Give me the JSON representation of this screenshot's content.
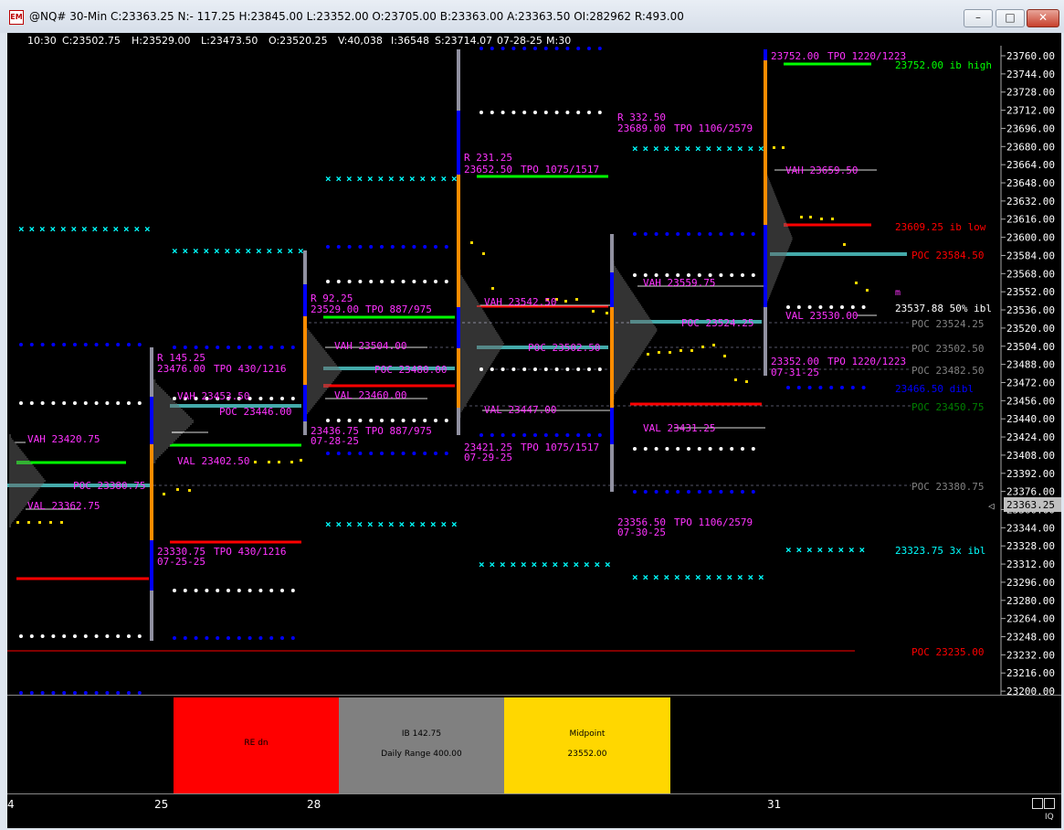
{
  "window": {
    "title": "@NQ# 30-Min C:23363.25 N:- 117.25 H:23845.00 L:23352.00 O:23705.00 B:23363.00 A:23363.50 OI:282962 R:493.00",
    "icon_label": "EM",
    "minimize": "–",
    "maximize": "□",
    "close": "✕"
  },
  "info_bar": {
    "time": "10:30",
    "close": "C:23502.75",
    "high": "H:23529.00",
    "low": "L:23473.50",
    "open": "O:23520.25",
    "volume": "V:40,038",
    "interest": "I:36548",
    "s": "S:23714.07",
    "date": "07-28-25",
    "interval": "M:30"
  },
  "price_axis": {
    "ticks": [
      "23760.00",
      "23744.00",
      "23728.00",
      "23712.00",
      "23696.00",
      "23680.00",
      "23664.00",
      "23648.00",
      "23632.00",
      "23616.00",
      "23600.00",
      "23584.00",
      "23568.00",
      "23552.00",
      "23536.00",
      "23520.00",
      "23504.00",
      "23488.00",
      "23472.00",
      "23456.00",
      "23440.00",
      "23424.00",
      "23408.00",
      "23392.00",
      "23376.00",
      "23360.00",
      "23344.00",
      "23328.00",
      "23312.00",
      "23296.00",
      "23280.00",
      "23264.00",
      "23248.00",
      "23232.00",
      "23216.00",
      "23200.00"
    ],
    "current": "23363.25"
  },
  "day_stats": [
    {
      "range": "R 145.25",
      "high": "23476.00",
      "tpo_top": "TPO 430/1216",
      "vah": "VAH 23453.50",
      "poc": "POC 23446.00",
      "val": "VAL 23402.50",
      "low": "23330.75",
      "tpo_bottom": "TPO 430/1216",
      "date": "07-25-25"
    },
    {
      "range": "R 92.25",
      "high": "23529.00",
      "tpo_top": "TPO 887/975",
      "vah": "VAH 23504.00",
      "poc": "POC 23480.00",
      "val": "VAL 23460.00",
      "low": "23436.75",
      "tpo_bottom": "TPO 887/975",
      "date": "07-28-25"
    },
    {
      "range": "R 231.25",
      "high": "23652.50",
      "tpo_top": "TPO 1075/1517",
      "vah": "VAH 23542.50",
      "poc": "POC 23502.50",
      "val": "VAL 23447.00",
      "low": "23421.25",
      "tpo_bottom": "TPO 1075/1517",
      "date": "07-29-25"
    },
    {
      "range": "R 332.50",
      "high": "23689.00",
      "tpo_top": "TPO 1106/2579",
      "vah": "VAH 23559.75",
      "poc": "POC 23524.25",
      "val": "VAL 23431.25",
      "low": "23356.50",
      "tpo_bottom": "TPO 1106/2579",
      "date": "07-30-25"
    },
    {
      "high": "23752.00",
      "tpo_top": "TPO 1220/1223",
      "vah": "VAH 23659.50",
      "val": "VAL 23530.00",
      "low": "23352.00",
      "tpo_bottom": "TPO 1220/1223",
      "date": "07-31-25"
    }
  ],
  "prev_day": {
    "vah": "VAH 23420.75",
    "poc": "POC 23380.75",
    "val": "VAL 23362.75"
  },
  "level_labels": [
    {
      "text": "23752.00 ib high",
      "color": "#00ff00"
    },
    {
      "text": "23609.25 ib low",
      "color": "#ff0000"
    },
    {
      "text": "POC 23584.50",
      "color": "#ff0000"
    },
    {
      "text": "m",
      "color": "#ff33ff"
    },
    {
      "text": "23537.88 50% ibl",
      "color": "#ffffff"
    },
    {
      "text": "POC 23524.25",
      "color": "#808080"
    },
    {
      "text": "POC 23502.50",
      "color": "#808080"
    },
    {
      "text": "POC 23482.50",
      "color": "#808080"
    },
    {
      "text": "23466.50 dibl",
      "color": "#0000ff"
    },
    {
      "text": "POC 23450.75",
      "color": "#008000"
    },
    {
      "text": "POC 23380.75",
      "color": "#808080"
    },
    {
      "text": "23323.75 3x ibl",
      "color": "#00ffff"
    },
    {
      "text": "POC 23235.00",
      "color": "#ff0000"
    }
  ],
  "panel": {
    "re": {
      "label": "RE dn",
      "color": "#ff0000"
    },
    "ib": {
      "label1": "IB 142.75",
      "label2": "Daily Range 400.00",
      "color": "#808080"
    },
    "mid": {
      "label1": "Midpoint",
      "label2": "23552.00",
      "color": "#ffd700"
    }
  },
  "date_axis": {
    "labels": [
      "4",
      "25",
      "28",
      "31"
    ],
    "corner": "IQ"
  }
}
